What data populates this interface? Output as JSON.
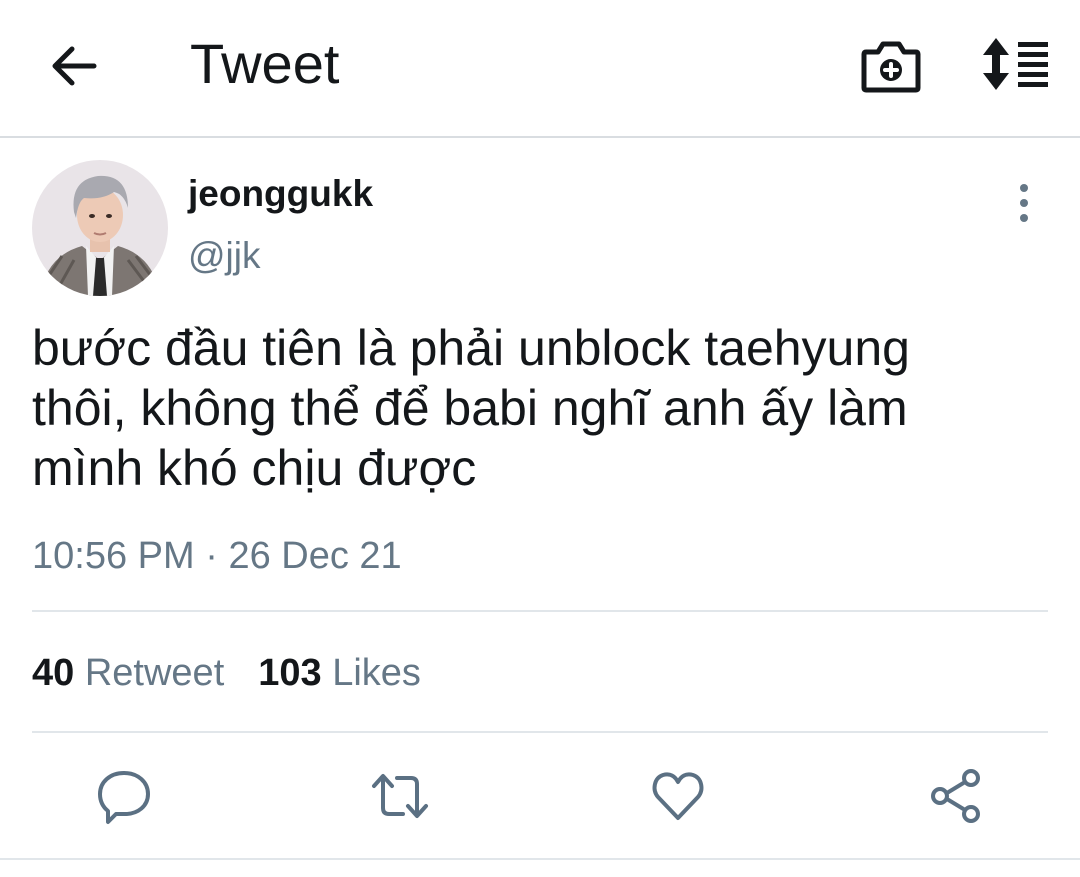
{
  "header": {
    "title": "Tweet",
    "icons": [
      "back-arrow-icon",
      "camera-plus-icon",
      "sort-list-icon"
    ]
  },
  "tweet": {
    "display_name": "jeonggukk",
    "handle": "@jjk",
    "text_lines": [
      "bước đầu tiên là phải unblock taehyung",
      "thôi, không thể để babi nghĩ anh ấy làm",
      "mình khó chịu được"
    ],
    "time": "10:56 PM",
    "separator": " · ",
    "date": "26 Dec 21"
  },
  "stats": {
    "retweet_count": "40",
    "retweet_label": "Retweet",
    "likes_count": "103",
    "likes_label": "Likes"
  },
  "actions": [
    "reply-icon",
    "retweet-icon",
    "like-icon",
    "share-icon"
  ],
  "colors": {
    "text": "#14171a",
    "muted": "#657786",
    "icon_muted": "#5b7083",
    "divider": "#e1e6ea"
  }
}
